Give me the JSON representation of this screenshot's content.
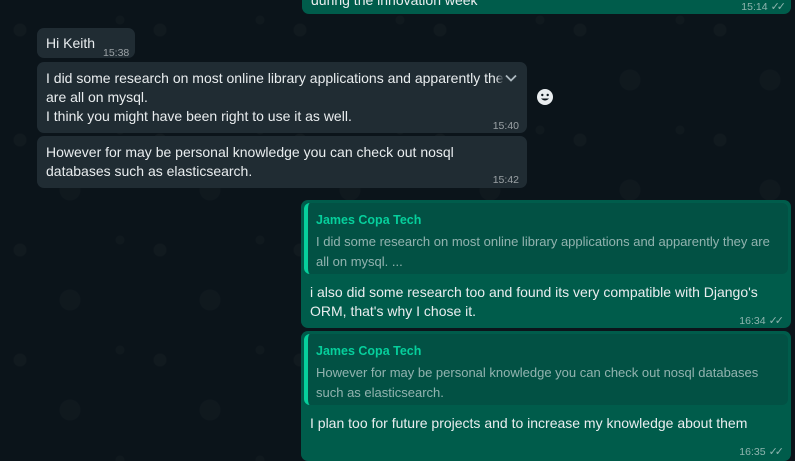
{
  "top_message": {
    "text": "during the innovation week",
    "time": "15:14",
    "status": "read-double-check-icon"
  },
  "incoming": [
    {
      "text": "Hi Keith",
      "time": "15:38"
    },
    {
      "text": "I did some research on most online library applications and apparently they\nare all on mysql.\nI think you might have been right to use it as well.",
      "time": "15:40"
    },
    {
      "text": "However for may be personal knowledge you can check out nosql\ndatabases such as elasticsearch.",
      "time": "15:42"
    }
  ],
  "replies": [
    {
      "quote_author": "James Copa Tech",
      "quote_text": "I did some research on most online library applications and apparently they are all on mysql. ...",
      "text": "i also did some research too and found its very compatible with Django's\nORM, that's why I chose it.",
      "time": "16:34"
    },
    {
      "quote_author": "James Copa Tech",
      "quote_text": "However for may be personal knowledge you can check out nosql databases such as elasticsearch.",
      "text": "I plan too for future projects and to increase my knowledge about them",
      "time": "16:35"
    }
  ],
  "colors": {
    "background": "#0b141a",
    "incoming_bubble": "#202c33",
    "outgoing_bubble": "#005c4b",
    "quote_accent": "#06cf9c"
  },
  "icons": {
    "message_menu": "chevron-down-icon",
    "reaction": "emoji-icon",
    "read_status": "double-check-icon"
  }
}
